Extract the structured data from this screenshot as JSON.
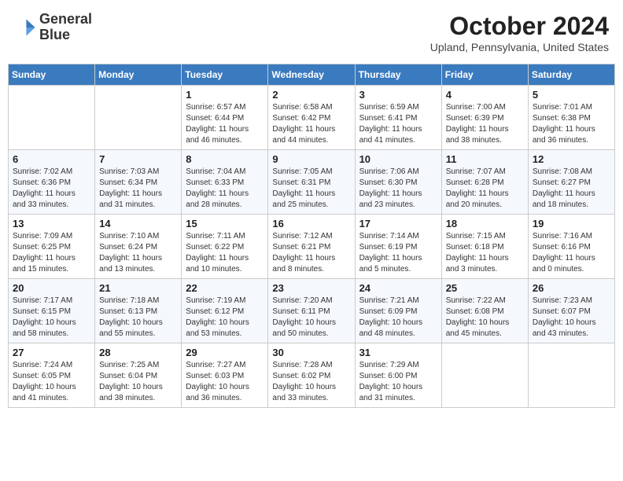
{
  "header": {
    "logo_line1": "General",
    "logo_line2": "Blue",
    "month_title": "October 2024",
    "location": "Upland, Pennsylvania, United States"
  },
  "days_of_week": [
    "Sunday",
    "Monday",
    "Tuesday",
    "Wednesday",
    "Thursday",
    "Friday",
    "Saturday"
  ],
  "weeks": [
    [
      {
        "num": "",
        "info": ""
      },
      {
        "num": "",
        "info": ""
      },
      {
        "num": "1",
        "info": "Sunrise: 6:57 AM\nSunset: 6:44 PM\nDaylight: 11 hours\nand 46 minutes."
      },
      {
        "num": "2",
        "info": "Sunrise: 6:58 AM\nSunset: 6:42 PM\nDaylight: 11 hours\nand 44 minutes."
      },
      {
        "num": "3",
        "info": "Sunrise: 6:59 AM\nSunset: 6:41 PM\nDaylight: 11 hours\nand 41 minutes."
      },
      {
        "num": "4",
        "info": "Sunrise: 7:00 AM\nSunset: 6:39 PM\nDaylight: 11 hours\nand 38 minutes."
      },
      {
        "num": "5",
        "info": "Sunrise: 7:01 AM\nSunset: 6:38 PM\nDaylight: 11 hours\nand 36 minutes."
      }
    ],
    [
      {
        "num": "6",
        "info": "Sunrise: 7:02 AM\nSunset: 6:36 PM\nDaylight: 11 hours\nand 33 minutes."
      },
      {
        "num": "7",
        "info": "Sunrise: 7:03 AM\nSunset: 6:34 PM\nDaylight: 11 hours\nand 31 minutes."
      },
      {
        "num": "8",
        "info": "Sunrise: 7:04 AM\nSunset: 6:33 PM\nDaylight: 11 hours\nand 28 minutes."
      },
      {
        "num": "9",
        "info": "Sunrise: 7:05 AM\nSunset: 6:31 PM\nDaylight: 11 hours\nand 25 minutes."
      },
      {
        "num": "10",
        "info": "Sunrise: 7:06 AM\nSunset: 6:30 PM\nDaylight: 11 hours\nand 23 minutes."
      },
      {
        "num": "11",
        "info": "Sunrise: 7:07 AM\nSunset: 6:28 PM\nDaylight: 11 hours\nand 20 minutes."
      },
      {
        "num": "12",
        "info": "Sunrise: 7:08 AM\nSunset: 6:27 PM\nDaylight: 11 hours\nand 18 minutes."
      }
    ],
    [
      {
        "num": "13",
        "info": "Sunrise: 7:09 AM\nSunset: 6:25 PM\nDaylight: 11 hours\nand 15 minutes."
      },
      {
        "num": "14",
        "info": "Sunrise: 7:10 AM\nSunset: 6:24 PM\nDaylight: 11 hours\nand 13 minutes."
      },
      {
        "num": "15",
        "info": "Sunrise: 7:11 AM\nSunset: 6:22 PM\nDaylight: 11 hours\nand 10 minutes."
      },
      {
        "num": "16",
        "info": "Sunrise: 7:12 AM\nSunset: 6:21 PM\nDaylight: 11 hours\nand 8 minutes."
      },
      {
        "num": "17",
        "info": "Sunrise: 7:14 AM\nSunset: 6:19 PM\nDaylight: 11 hours\nand 5 minutes."
      },
      {
        "num": "18",
        "info": "Sunrise: 7:15 AM\nSunset: 6:18 PM\nDaylight: 11 hours\nand 3 minutes."
      },
      {
        "num": "19",
        "info": "Sunrise: 7:16 AM\nSunset: 6:16 PM\nDaylight: 11 hours\nand 0 minutes."
      }
    ],
    [
      {
        "num": "20",
        "info": "Sunrise: 7:17 AM\nSunset: 6:15 PM\nDaylight: 10 hours\nand 58 minutes."
      },
      {
        "num": "21",
        "info": "Sunrise: 7:18 AM\nSunset: 6:13 PM\nDaylight: 10 hours\nand 55 minutes."
      },
      {
        "num": "22",
        "info": "Sunrise: 7:19 AM\nSunset: 6:12 PM\nDaylight: 10 hours\nand 53 minutes."
      },
      {
        "num": "23",
        "info": "Sunrise: 7:20 AM\nSunset: 6:11 PM\nDaylight: 10 hours\nand 50 minutes."
      },
      {
        "num": "24",
        "info": "Sunrise: 7:21 AM\nSunset: 6:09 PM\nDaylight: 10 hours\nand 48 minutes."
      },
      {
        "num": "25",
        "info": "Sunrise: 7:22 AM\nSunset: 6:08 PM\nDaylight: 10 hours\nand 45 minutes."
      },
      {
        "num": "26",
        "info": "Sunrise: 7:23 AM\nSunset: 6:07 PM\nDaylight: 10 hours\nand 43 minutes."
      }
    ],
    [
      {
        "num": "27",
        "info": "Sunrise: 7:24 AM\nSunset: 6:05 PM\nDaylight: 10 hours\nand 41 minutes."
      },
      {
        "num": "28",
        "info": "Sunrise: 7:25 AM\nSunset: 6:04 PM\nDaylight: 10 hours\nand 38 minutes."
      },
      {
        "num": "29",
        "info": "Sunrise: 7:27 AM\nSunset: 6:03 PM\nDaylight: 10 hours\nand 36 minutes."
      },
      {
        "num": "30",
        "info": "Sunrise: 7:28 AM\nSunset: 6:02 PM\nDaylight: 10 hours\nand 33 minutes."
      },
      {
        "num": "31",
        "info": "Sunrise: 7:29 AM\nSunset: 6:00 PM\nDaylight: 10 hours\nand 31 minutes."
      },
      {
        "num": "",
        "info": ""
      },
      {
        "num": "",
        "info": ""
      }
    ]
  ]
}
